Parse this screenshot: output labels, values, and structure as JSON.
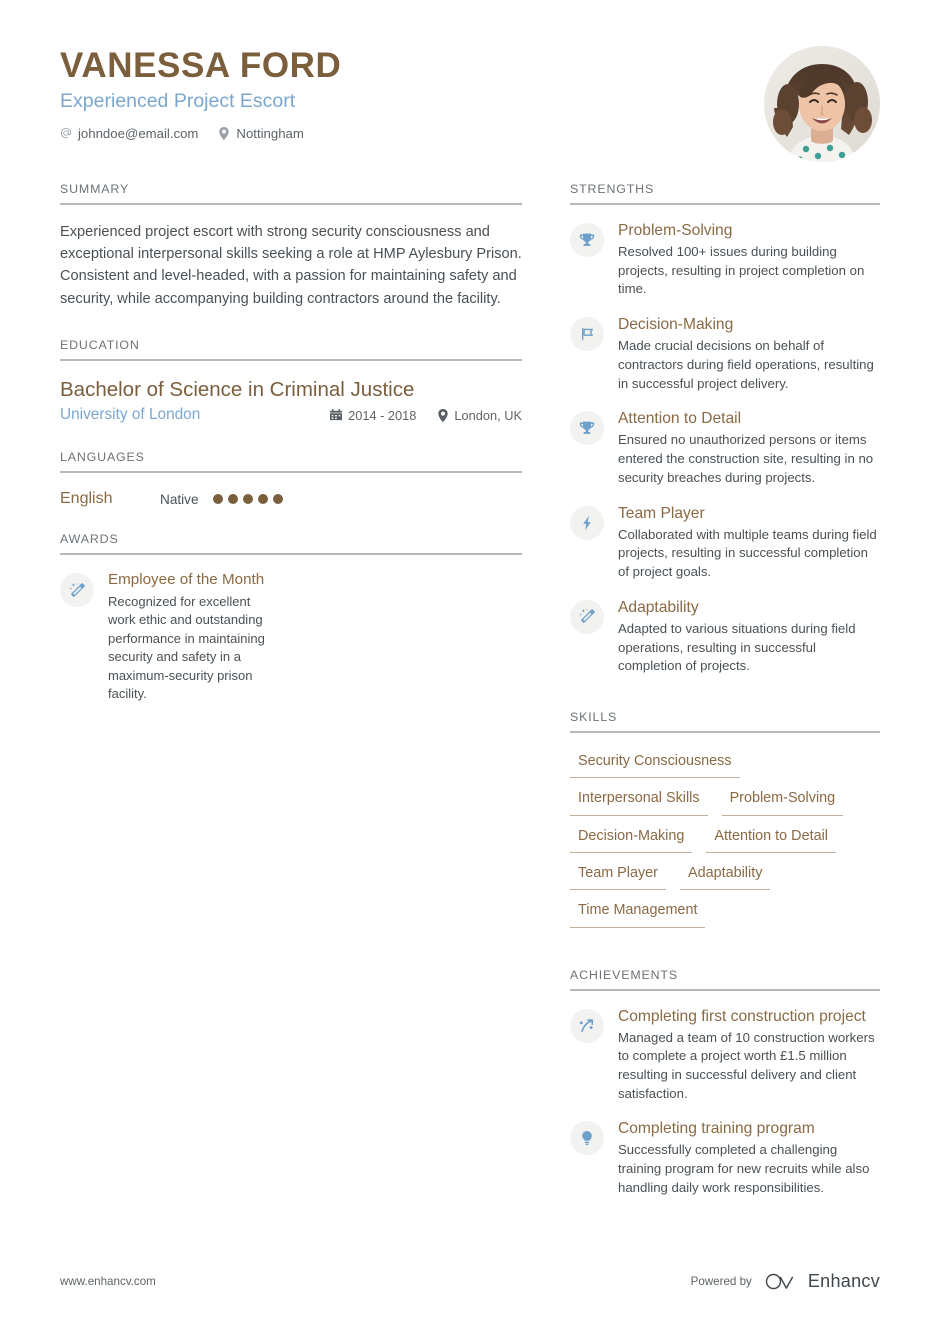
{
  "header": {
    "name": "VANESSA FORD",
    "job_title": "Experienced Project Escort",
    "contacts": [
      {
        "icon": "at-sign-icon",
        "text": "johndoe@email.com"
      },
      {
        "icon": "map-pin-icon",
        "text": "Nottingham"
      }
    ],
    "avatar_alt": "profile-photo"
  },
  "colors": {
    "brand_brown": "#7b5e3c",
    "accent_blue": "#7aa7cf",
    "icon_blue": "#6ea0cc",
    "body_gray": "#4a5156",
    "heading_gray": "#6d7378",
    "rule_gray": "#b8b8b8",
    "skill_underline": "#c3b09a",
    "icon_circle_bg": "#f2f2f0"
  },
  "sections": {
    "summary": {
      "title": "SUMMARY",
      "text": "Experienced project escort with strong security consciousness and exceptional interpersonal skills seeking a role at HMP Aylesbury Prison. Consistent and level-headed, with a passion for maintaining safety and security, while accompanying building contractors around the facility."
    },
    "education": {
      "title": "EDUCATION",
      "degree": "Bachelor of Science in Criminal Justice",
      "school": "University of London",
      "date_icon": "calendar-icon",
      "dates": "2014 - 2018",
      "location_icon": "map-pin-icon",
      "location": "London, UK"
    },
    "languages": {
      "title": "LANGUAGES",
      "items": [
        {
          "name": "English",
          "level": "Native",
          "dots_filled": 5,
          "dots_total": 5
        }
      ]
    },
    "awards": {
      "title": "AWARDS",
      "items": [
        {
          "icon": "magic-wand-icon",
          "title": "Employee of the Month",
          "desc": "Recognized for excellent work ethic and outstanding performance in maintaining security and safety in a maximum-security prison facility."
        }
      ]
    },
    "strengths": {
      "title": "STRENGTHS",
      "items": [
        {
          "icon": "trophy-icon",
          "title": "Problem-Solving",
          "desc": "Resolved 100+ issues during building projects, resulting in project completion on time."
        },
        {
          "icon": "flag-icon",
          "title": "Decision-Making",
          "desc": "Made crucial decisions on behalf of contractors during field operations, resulting in successful project delivery."
        },
        {
          "icon": "trophy-icon",
          "title": "Attention to Detail",
          "desc": "Ensured no unauthorized persons or items entered the construction site, resulting in no security breaches during projects."
        },
        {
          "icon": "lightning-bolt-icon",
          "title": "Team Player",
          "desc": "Collaborated with multiple teams during field projects, resulting in successful completion of project goals."
        },
        {
          "icon": "magic-wand-icon",
          "title": "Adaptability",
          "desc": "Adapted to various situations during field operations, resulting in successful completion of projects."
        }
      ]
    },
    "skills": {
      "title": "SKILLS",
      "items": [
        "Security Consciousness",
        "Interpersonal Skills",
        "Problem-Solving",
        "Decision-Making",
        "Attention to Detail",
        "Team Player",
        "Adaptability",
        "Time Management"
      ]
    },
    "achievements": {
      "title": "ACHIEVEMENTS",
      "items": [
        {
          "icon": "trending-arrow-icon",
          "title": "Completing first construction project",
          "desc": "Managed a team of 10 construction workers to complete a project worth £1.5 million resulting in successful delivery and client satisfaction."
        },
        {
          "icon": "lightbulb-icon",
          "title": "Completing training program",
          "desc": "Successfully completed a challenging training program for new recruits while also handling daily work responsibilities."
        }
      ]
    }
  },
  "footer": {
    "url": "www.enhancv.com",
    "powered_by": "Powered by",
    "brand_name": "Enhancv",
    "brand_logo_icon": "enhancv-logo-icon"
  }
}
